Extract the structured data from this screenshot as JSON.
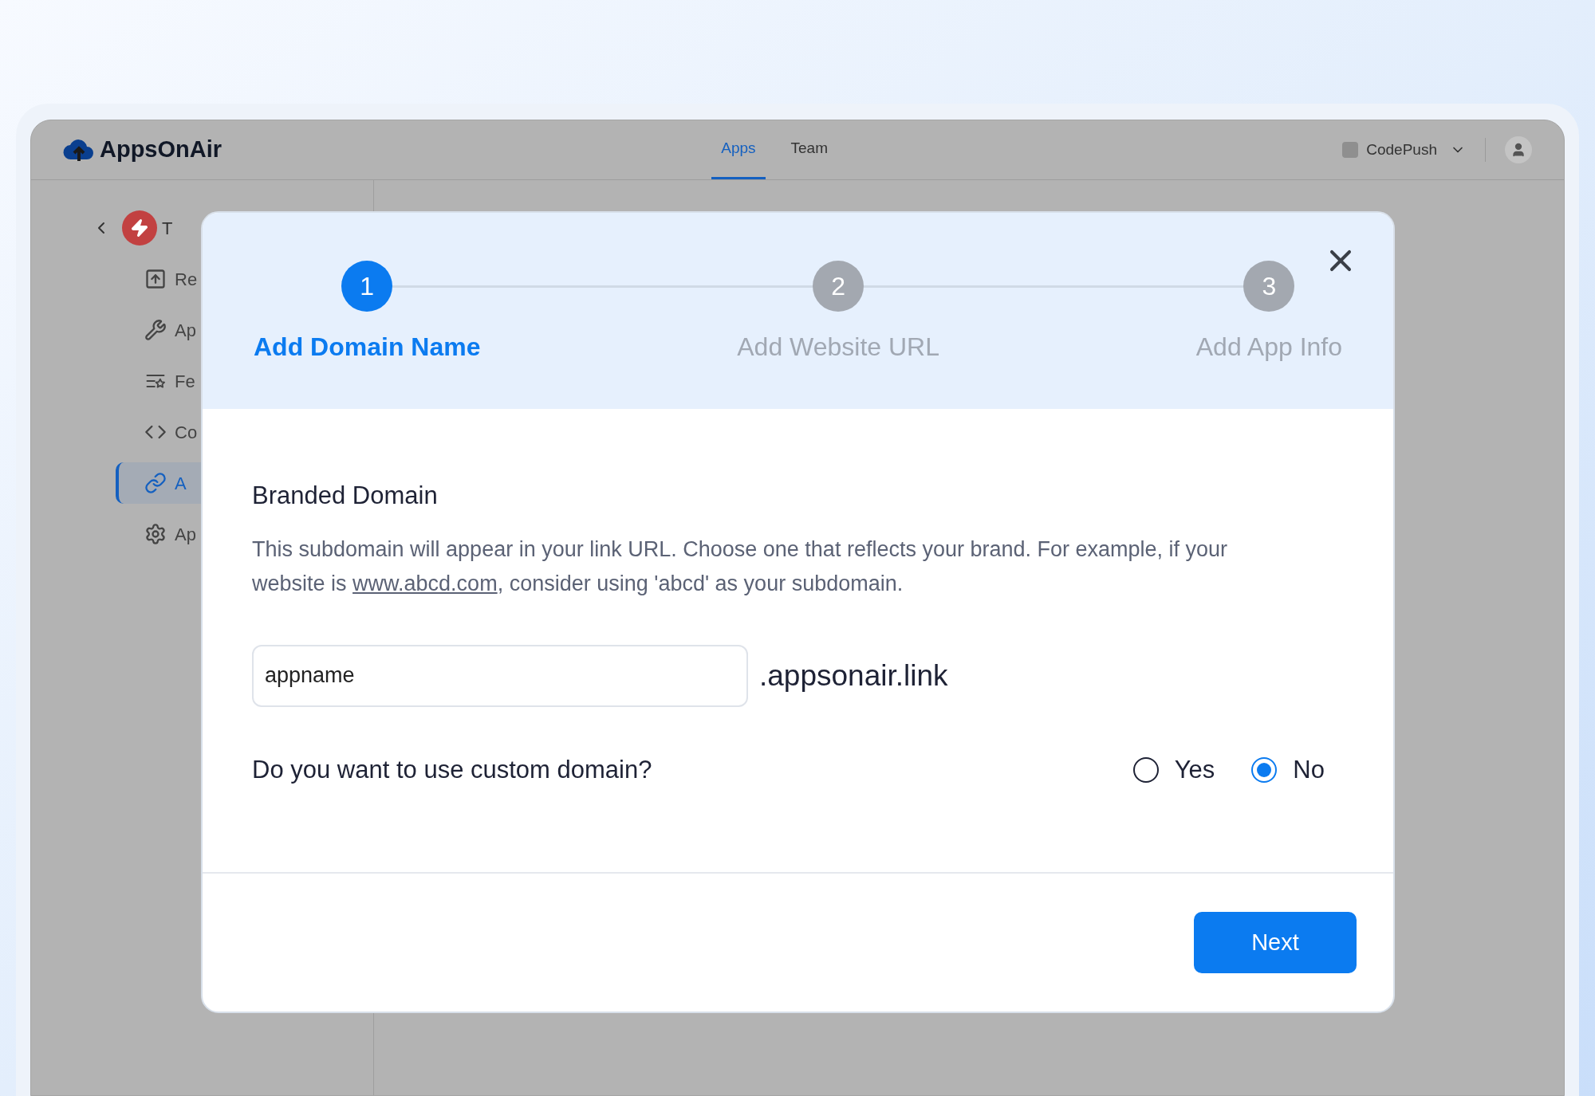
{
  "header": {
    "logo": "AppsOnAir",
    "tabs": [
      {
        "label": "Apps",
        "selected": true
      },
      {
        "label": "Team",
        "selected": false
      }
    ],
    "workspace": "CodePush"
  },
  "sidebar": {
    "app_name": "T",
    "items": [
      {
        "label": "Re",
        "selected": false
      },
      {
        "label": "Ap",
        "selected": false
      },
      {
        "label": "Fe",
        "selected": false
      },
      {
        "label": "Co",
        "selected": false
      },
      {
        "label": "A",
        "selected": true
      },
      {
        "label": "Ap",
        "selected": false
      }
    ]
  },
  "dialog": {
    "steps": [
      {
        "number": "1",
        "label": "Add Domain Name",
        "active": true
      },
      {
        "number": "2",
        "label": "Add Website URL",
        "active": false
      },
      {
        "number": "3",
        "label": "Add App Info",
        "active": false
      }
    ],
    "section_title": "Branded Domain",
    "description_before": "This subdomain will appear in your link URL. Choose one that reflects your brand. For example, if your website is ",
    "description_link": "www.abcd.com",
    "description_after": ", consider using 'abcd' as your subdomain.",
    "field": {
      "value": "appname",
      "suffix": ".appsonair.link"
    },
    "question": "Do you want to use custom domain?",
    "options": [
      {
        "label": "Yes",
        "selected": false
      },
      {
        "label": "No",
        "selected": true
      }
    ],
    "next_button": "Next"
  }
}
